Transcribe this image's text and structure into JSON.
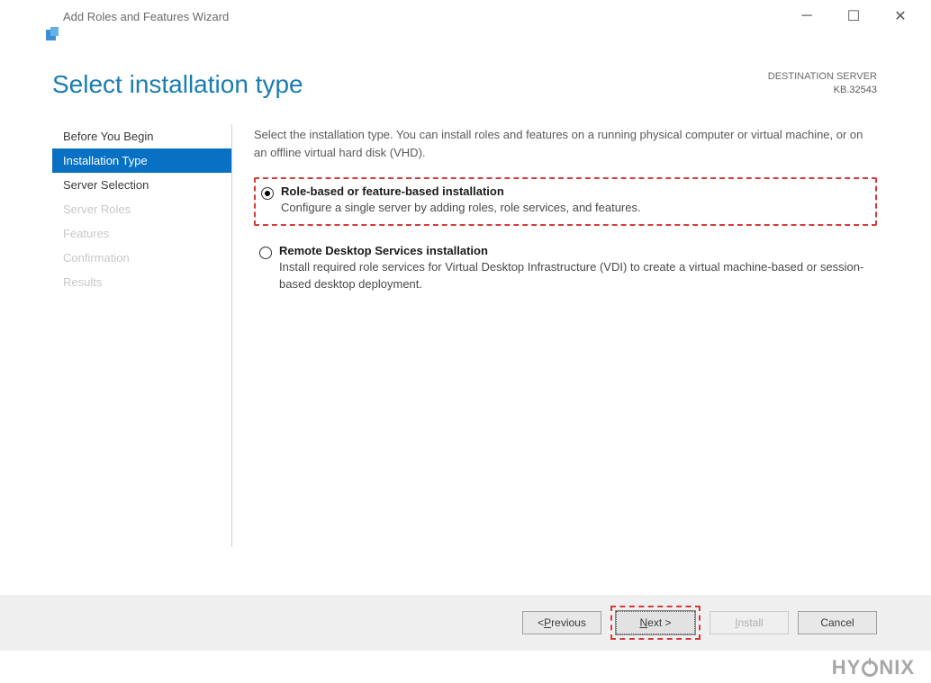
{
  "titlebar": {
    "title": "Add Roles and Features Wizard"
  },
  "header": {
    "page_title": "Select installation type",
    "dest_label": "DESTINATION SERVER",
    "dest_server": "KB.32543"
  },
  "sidebar": {
    "items": [
      {
        "label": "Before You Begin",
        "state": "enabled"
      },
      {
        "label": "Installation Type",
        "state": "active"
      },
      {
        "label": "Server Selection",
        "state": "enabled"
      },
      {
        "label": "Server Roles",
        "state": "disabled"
      },
      {
        "label": "Features",
        "state": "disabled"
      },
      {
        "label": "Confirmation",
        "state": "disabled"
      },
      {
        "label": "Results",
        "state": "disabled"
      }
    ]
  },
  "pane": {
    "intro": "Select the installation type. You can install roles and features on a running physical computer or virtual machine, or on an offline virtual hard disk (VHD).",
    "options": [
      {
        "title": "Role-based or feature-based installation",
        "desc": "Configure a single server by adding roles, role services, and features.",
        "selected": true,
        "highlighted": true
      },
      {
        "title": "Remote Desktop Services installation",
        "desc": "Install required role services for Virtual Desktop Infrastructure (VDI) to create a virtual machine-based or session-based desktop deployment.",
        "selected": false,
        "highlighted": false
      }
    ]
  },
  "footer": {
    "previous_pre": "< ",
    "previous_u": "P",
    "previous_post": "revious",
    "next_u": "N",
    "next_post": "ext >",
    "install_u": "I",
    "install_post": "nstall",
    "cancel": "Cancel"
  },
  "watermark": {
    "pre": "HY",
    "post": "NIX"
  }
}
